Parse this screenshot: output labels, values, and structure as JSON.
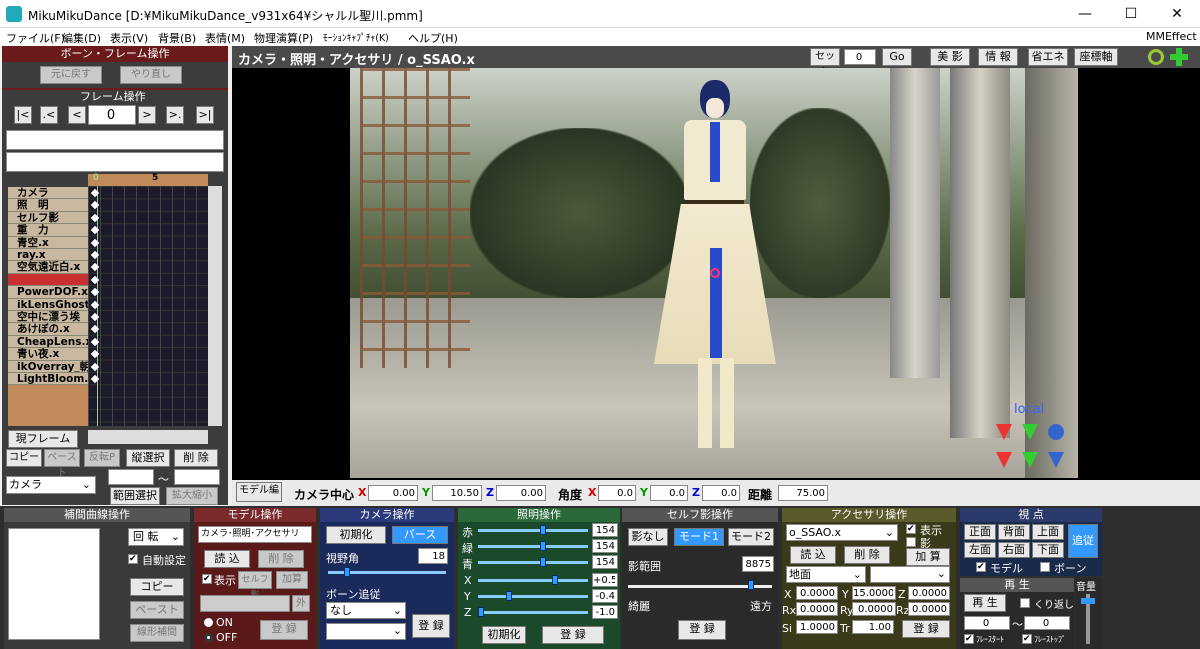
{
  "window": {
    "title": "MikuMikuDance [D:¥MikuMikuDance_v931x64¥シャルル聖川.pmm]",
    "min": "—",
    "max": "☐",
    "close": "✕"
  },
  "menu": [
    "ファイル(F)",
    "編集(D)",
    "表示(V)",
    "背景(B)",
    "表情(M)",
    "物理演算(P)",
    "ﾓｰｼｮﾝｷｬﾌﾟﾁｬ(K)",
    "ヘルプ(H)"
  ],
  "menu_right": "MMEffect",
  "bone_frame": {
    "title": "ボーン・フレーム操作",
    "undo": "元に戻す",
    "redo": "やり直し"
  },
  "frame_ops": {
    "title": "フレーム操作",
    "frame": "0",
    "first": "|<",
    ".prev": ".<",
    "prev": "<",
    "next": ">",
    "nextkey": ">.",
    "last": ">|"
  },
  "timeline": {
    "tick0": "0",
    "tick5": "5",
    "tracks": [
      "カメラ",
      "照　明",
      "セルフ影",
      "重　力",
      "青空.x",
      "ray.x",
      "空気遠近白.x",
      "",
      "PowerDOF.x",
      "ikLensGhost",
      "空中に漂う埃",
      "あけぼの.x",
      "CheapLens.x",
      "青い夜.x",
      "ikOverray_朝",
      "LightBloom.x"
    ]
  },
  "left_buttons": {
    "current": "現フレーム",
    "copy": "コピー",
    "paste": "ペースト",
    "reverse": "反転P",
    "col_select": "縦選択",
    "delete": "削 除",
    "range_select": "範囲選択",
    "zoom": "拡大縮小",
    "dropdown": "カメラ",
    "tilde": "～"
  },
  "viewport": {
    "header": "カメラ・照明・アクセサリ / o_SSAO.x",
    "set": "セット",
    "set_val": "0",
    "go": "Go",
    "btns": [
      "美 影",
      "情 報",
      "省エネ",
      "座標軸"
    ],
    "local": "local"
  },
  "camera_bar": {
    "model_edit": "モデル編",
    "center": "カメラ中心",
    "x": "0.00",
    "y": "10.50",
    "z": "0.00",
    "angle": "角度",
    "ax": "0.0",
    "ay": "0.0",
    "az": "0.0",
    "dist_label": "距離",
    "dist": "75.00"
  },
  "interp": {
    "title": "補間曲線操作",
    "rot": "回 転",
    "auto": "自動設定",
    "copy": "コピー",
    "paste": "ペースト",
    "linear": "線形補間"
  },
  "model_ops": {
    "title": "モデル操作",
    "sel": "カメラ･照明･アクセサリ",
    "load": "読 込",
    "del": "削 除",
    "show": "表示",
    "selfshadow": "セルフ影",
    "add": "加算",
    "ext": "外",
    "on": "ON",
    "off": "OFF",
    "reg": "登 録"
  },
  "cam_ops": {
    "title": "カメラ操作",
    "init": "初期化",
    "persp": "パース",
    "fov": "視野角",
    "fov_val": "18",
    "follow": "ボーン追従",
    "none": "なし",
    "reg": "登 録"
  },
  "light_ops": {
    "title": "照明操作",
    "r": "赤",
    "g": "緑",
    "b": "青",
    "rv": "154",
    "gv": "154",
    "bv": "154",
    "x": "X",
    "y": "Y",
    "z": "Z",
    "xv": "+0.5",
    "yv": "-0.4",
    "zv": "-1.0",
    "init": "初期化",
    "reg": "登 録"
  },
  "shadow_ops": {
    "title": "セルフ影操作",
    "none": "影なし",
    "mode1": "モード1",
    "mode2": "モード2",
    "range": "影範囲",
    "range_val": "8875",
    "near": "綺麗",
    "far": "遠方",
    "reg": "登 録"
  },
  "acc_ops": {
    "title": "アクセサリ操作",
    "sel": "o_SSAO.x",
    "show": "表示",
    "shadow": "影",
    "load": "読 込",
    "del": "削 除",
    "add": "加 算",
    "parent": "地面",
    "x": "0.0000",
    "y": "15.0000",
    "z": "0.0000",
    "rx": "0.0000",
    "ry": "0.0000",
    "rz": "0.0000",
    "si": "1.0000",
    "tr": "1.00",
    "reg": "登 録"
  },
  "view_ops": {
    "title": "視 点",
    "front": "正面",
    "back": "背面",
    "top": "上面",
    "left": "左面",
    "right": "右面",
    "bottom": "下面",
    "follow": "追従",
    "model": "モデル",
    "bone": "ボーン"
  },
  "play": {
    "title": "再 生",
    "play": "再 生",
    "loop": "くり返し",
    "from": "0",
    "tilde": "～",
    "to": "0",
    "fstart": "ﾌﾚｰｽﾀｰﾄ",
    "fstop": "ﾌﾚｰｽﾄｯﾌﾟ",
    "volume": "音量"
  }
}
